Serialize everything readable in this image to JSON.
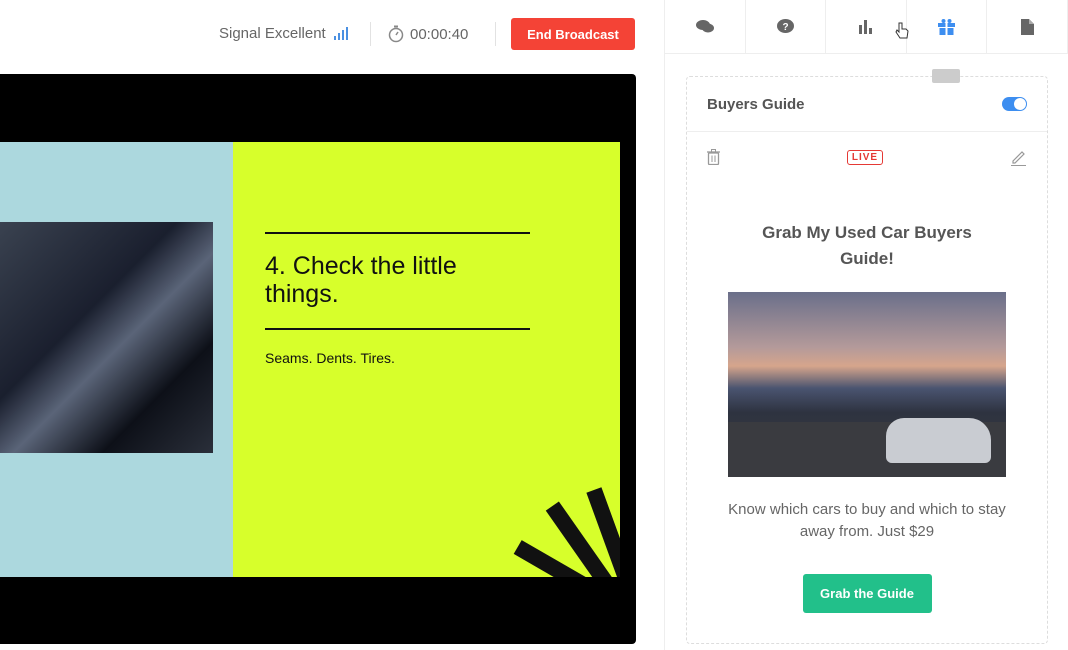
{
  "header": {
    "signal_label": "Signal Excellent",
    "timer": "00:00:40",
    "end_button": "End Broadcast"
  },
  "slide": {
    "title": "4. Check the little things.",
    "subtitle": "Seams. Dents. Tires."
  },
  "panel": {
    "tabs": [
      {
        "icon": "chat-icon"
      },
      {
        "icon": "question-icon"
      },
      {
        "icon": "poll-icon"
      },
      {
        "icon": "gift-icon",
        "active": true
      },
      {
        "icon": "document-icon"
      }
    ],
    "card": {
      "title": "Buyers Guide",
      "enabled": true,
      "status_badge": "LIVE",
      "offer_title": "Grab My Used Car Buyers Guide!",
      "description": "Know which cars to buy and which to stay away from. Just $29",
      "cta": "Grab the Guide"
    }
  },
  "colors": {
    "accent": "#3d8ef0",
    "end": "#f44336",
    "cta": "#22c08a",
    "slide_bg": "#d7ff2b"
  }
}
